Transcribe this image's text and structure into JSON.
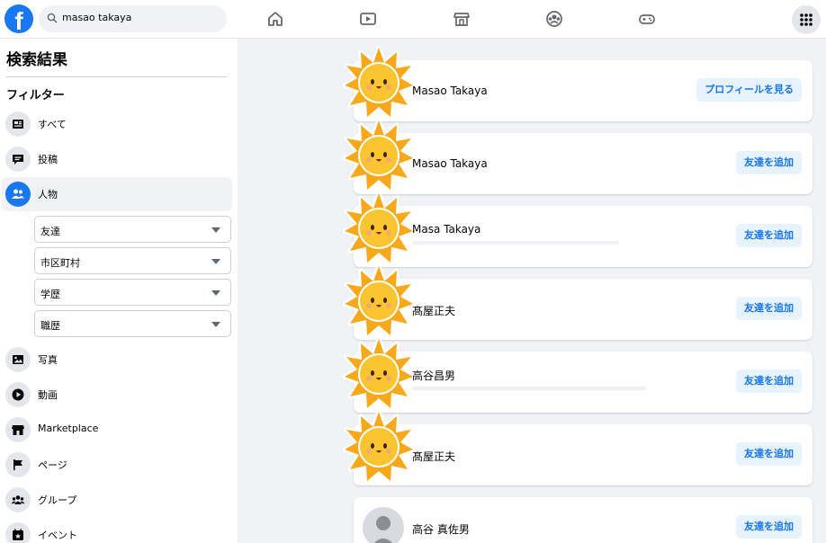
{
  "topbar": {
    "search_value": "masao takaya",
    "nav": [
      "home-icon",
      "watch-icon",
      "marketplace-icon",
      "groups-icon",
      "gaming-icon"
    ],
    "menu_icon": "grid-menu-icon"
  },
  "sidebar": {
    "title": "検索結果",
    "filter_heading": "フィルター",
    "items": [
      {
        "label": "すべて",
        "icon": "all-results-icon"
      },
      {
        "label": "投稿",
        "icon": "posts-icon"
      },
      {
        "label": "人物",
        "icon": "people-icon"
      },
      {
        "label": "写真",
        "icon": "photos-icon"
      },
      {
        "label": "動画",
        "icon": "video-icon"
      },
      {
        "label": "Marketplace",
        "icon": "marketplace-icon"
      },
      {
        "label": "ページ",
        "icon": "pages-icon"
      },
      {
        "label": "グループ",
        "icon": "groups-icon"
      },
      {
        "label": "イベント",
        "icon": "events-icon"
      }
    ],
    "dropdowns": [
      "友達",
      "市区町村",
      "学歴",
      "職歴"
    ]
  },
  "results": [
    {
      "name": "Masao Takaya",
      "button": "プロフィールを見る"
    },
    {
      "name": "Masao Takaya",
      "button": "友達を追加"
    },
    {
      "name": "Masa Takaya",
      "button": "友達を追加"
    },
    {
      "name": "髙屋正夫",
      "button": "友達を追加"
    },
    {
      "name": "高谷昌男",
      "button": "友達を追加"
    },
    {
      "name": "髙屋正夫",
      "button": "友達を追加"
    },
    {
      "name": "高谷 真佐男",
      "button": "友達を追加"
    }
  ],
  "colors": {
    "accent": "#1877f2",
    "button_bg": "#e7f3ff",
    "page_bg": "#f0f2f5",
    "sun": "#f7b51e"
  }
}
